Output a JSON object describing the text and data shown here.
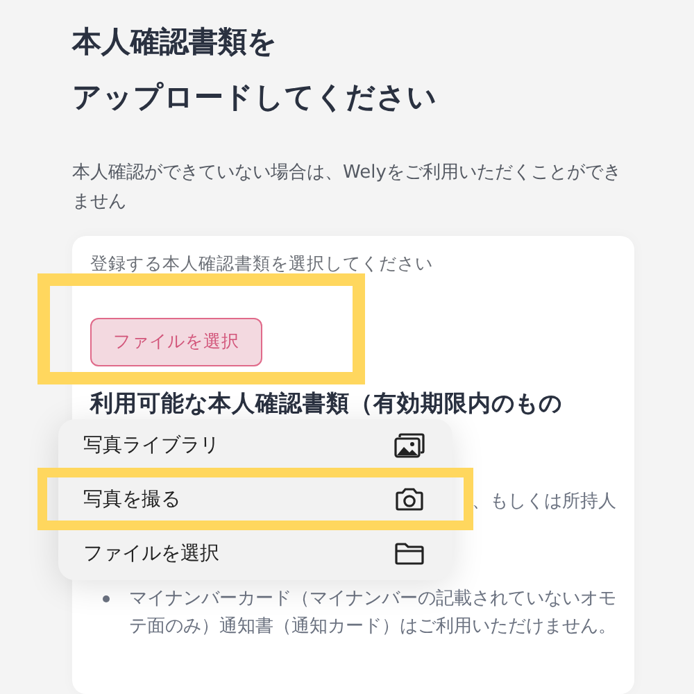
{
  "title_lines": [
    "本人確認書類を",
    "アップロードしてください"
  ],
  "description": "本人確認ができていない場合は、Welyをご利用いただくことができません",
  "card": {
    "label": "登録する本人確認書類を選択してください",
    "button": {
      "label": "ファイルを選択",
      "highlighted": true
    },
    "section_heading": "利用可能な本人確認書類（有効期限内のもの",
    "list": [
      {
        "kind": "fragment",
        "text": "、もしくは所持人"
      },
      {
        "kind": "bullet",
        "text": "マイナンバーカード（マイナンバーの記載されていないオモテ面のみ）通知書（通知カード）はご利用いただけません。"
      }
    ]
  },
  "menu": [
    {
      "label": "写真ライブラリ",
      "highlighted": false
    },
    {
      "label": "写真を撮る",
      "highlighted": true
    },
    {
      "label": "ファイルを選択",
      "highlighted": false
    }
  ]
}
